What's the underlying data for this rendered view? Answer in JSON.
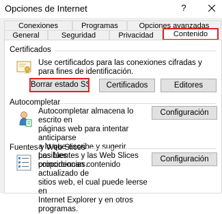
{
  "window": {
    "title": "Opciones de Internet",
    "help_label": "?"
  },
  "tabs": {
    "row1": [
      {
        "label": "Conexiones"
      },
      {
        "label": "Programas"
      },
      {
        "label": "Opciones avanzadas"
      }
    ],
    "row2": [
      {
        "label": "General"
      },
      {
        "label": "Seguridad"
      },
      {
        "label": "Privacidad"
      },
      {
        "label": "Contenido",
        "active": true
      }
    ]
  },
  "sections": {
    "certificados": {
      "title": "Certificados",
      "description": "Use certificados para las conexiones cifradas y para fines de identificación.",
      "buttons": {
        "borrar_ssl": "Borrar estado SSL",
        "certificados": "Certificados",
        "editores": "Editores"
      }
    },
    "autocompletar": {
      "title": "Autocompletar",
      "description_lines": [
        "Autocompletar almacena lo escrito en",
        "páginas web para intentar anticiparse",
        "a lo que escribe y sugerir posibles",
        "coincidencias."
      ],
      "button": "Configuración"
    },
    "fuentes": {
      "title": "Fuentes y Web Slices",
      "description_lines": [
        "Las fuentes y las Web Slices",
        "proporcionan contenido actualizado de",
        "sitios web, el cual puede leerse en",
        "Internet Explorer y en otros programas."
      ],
      "button": "Configuración"
    }
  },
  "colors": {
    "highlight": "#e02020",
    "dialog_bg": "#f0f0f0",
    "button_bg": "#e1e1e1"
  },
  "icons": {
    "close": "close-icon",
    "certificate": "certificate-icon",
    "autocomplete": "autocomplete-user-icon",
    "feeds": "feeds-list-icon"
  }
}
